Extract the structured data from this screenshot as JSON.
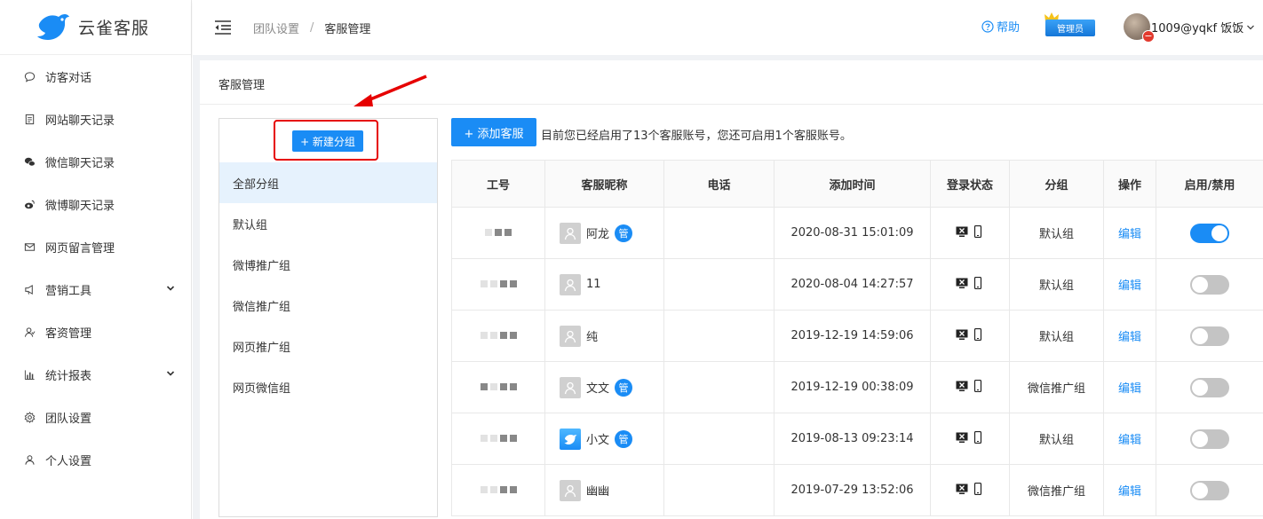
{
  "app": {
    "logo_text": "云雀客服"
  },
  "sidebar": {
    "items": [
      {
        "label": "访客对话",
        "icon": "chat-bubble-icon"
      },
      {
        "label": "网站聊天记录",
        "icon": "document-icon"
      },
      {
        "label": "微信聊天记录",
        "icon": "wechat-icon"
      },
      {
        "label": "微博聊天记录",
        "icon": "weibo-icon"
      },
      {
        "label": "网页留言管理",
        "icon": "mail-icon"
      },
      {
        "label": "营销工具",
        "icon": "megaphone-icon"
      },
      {
        "label": "客资管理",
        "icon": "user-group-icon"
      },
      {
        "label": "统计报表",
        "icon": "bar-chart-icon"
      },
      {
        "label": "团队设置",
        "icon": "gear-icon"
      },
      {
        "label": "个人设置",
        "icon": "user-icon"
      }
    ]
  },
  "header": {
    "breadcrumb": [
      "团队设置",
      "客服管理"
    ],
    "breadcrumb_sep": "/",
    "help_label": "帮助",
    "admin_label": "管理员",
    "avatar_badge": "−",
    "username": "1009@yqkf 饭饭"
  },
  "main": {
    "title": "客服管理",
    "new_group_label": "+ 新建分组",
    "groups": [
      "全部分组",
      "默认组",
      "微博推广组",
      "微信推广组",
      "网页推广组",
      "网页微信组"
    ],
    "add_staff_label": "+ 添加客服",
    "notice": "目前您已经启用了13个客服账号，您还可启用1个客服账号。",
    "table": {
      "headers": [
        "工号",
        "客服昵称",
        "电话",
        "添加时间",
        "登录状态",
        "分组",
        "操作",
        "启用/禁用"
      ],
      "rows": [
        {
          "nickname": "阿龙",
          "admin": "管",
          "phone": "",
          "time": "2020-08-31 15:01:09",
          "group": "默认组",
          "action": "编辑",
          "enabled": true,
          "avatar": "placeholder"
        },
        {
          "nickname": "11",
          "admin": "",
          "phone": "",
          "time": "2020-08-04 14:27:57",
          "group": "默认组",
          "action": "编辑",
          "enabled": false,
          "avatar": "placeholder"
        },
        {
          "nickname": "纯",
          "admin": "",
          "phone": "",
          "time": "2019-12-19 14:59:06",
          "group": "默认组",
          "action": "编辑",
          "enabled": false,
          "avatar": "placeholder"
        },
        {
          "nickname": "文文",
          "admin": "管",
          "phone": "",
          "time": "2019-12-19 00:38:09",
          "group": "微信推广组",
          "action": "编辑",
          "enabled": false,
          "avatar": "placeholder"
        },
        {
          "nickname": "小文",
          "admin": "管",
          "phone": "",
          "time": "2019-08-13 09:23:14",
          "group": "默认组",
          "action": "编辑",
          "enabled": false,
          "avatar": "bird"
        },
        {
          "nickname": "幽幽",
          "admin": "",
          "phone": "",
          "time": "2019-07-29 13:52:06",
          "group": "微信推广组",
          "action": "编辑",
          "enabled": false,
          "avatar": "placeholder"
        }
      ]
    }
  },
  "colors": {
    "accent": "#1a8cf5",
    "highlight_box": "#e60000",
    "active_group_bg": "#e6f2fd"
  }
}
